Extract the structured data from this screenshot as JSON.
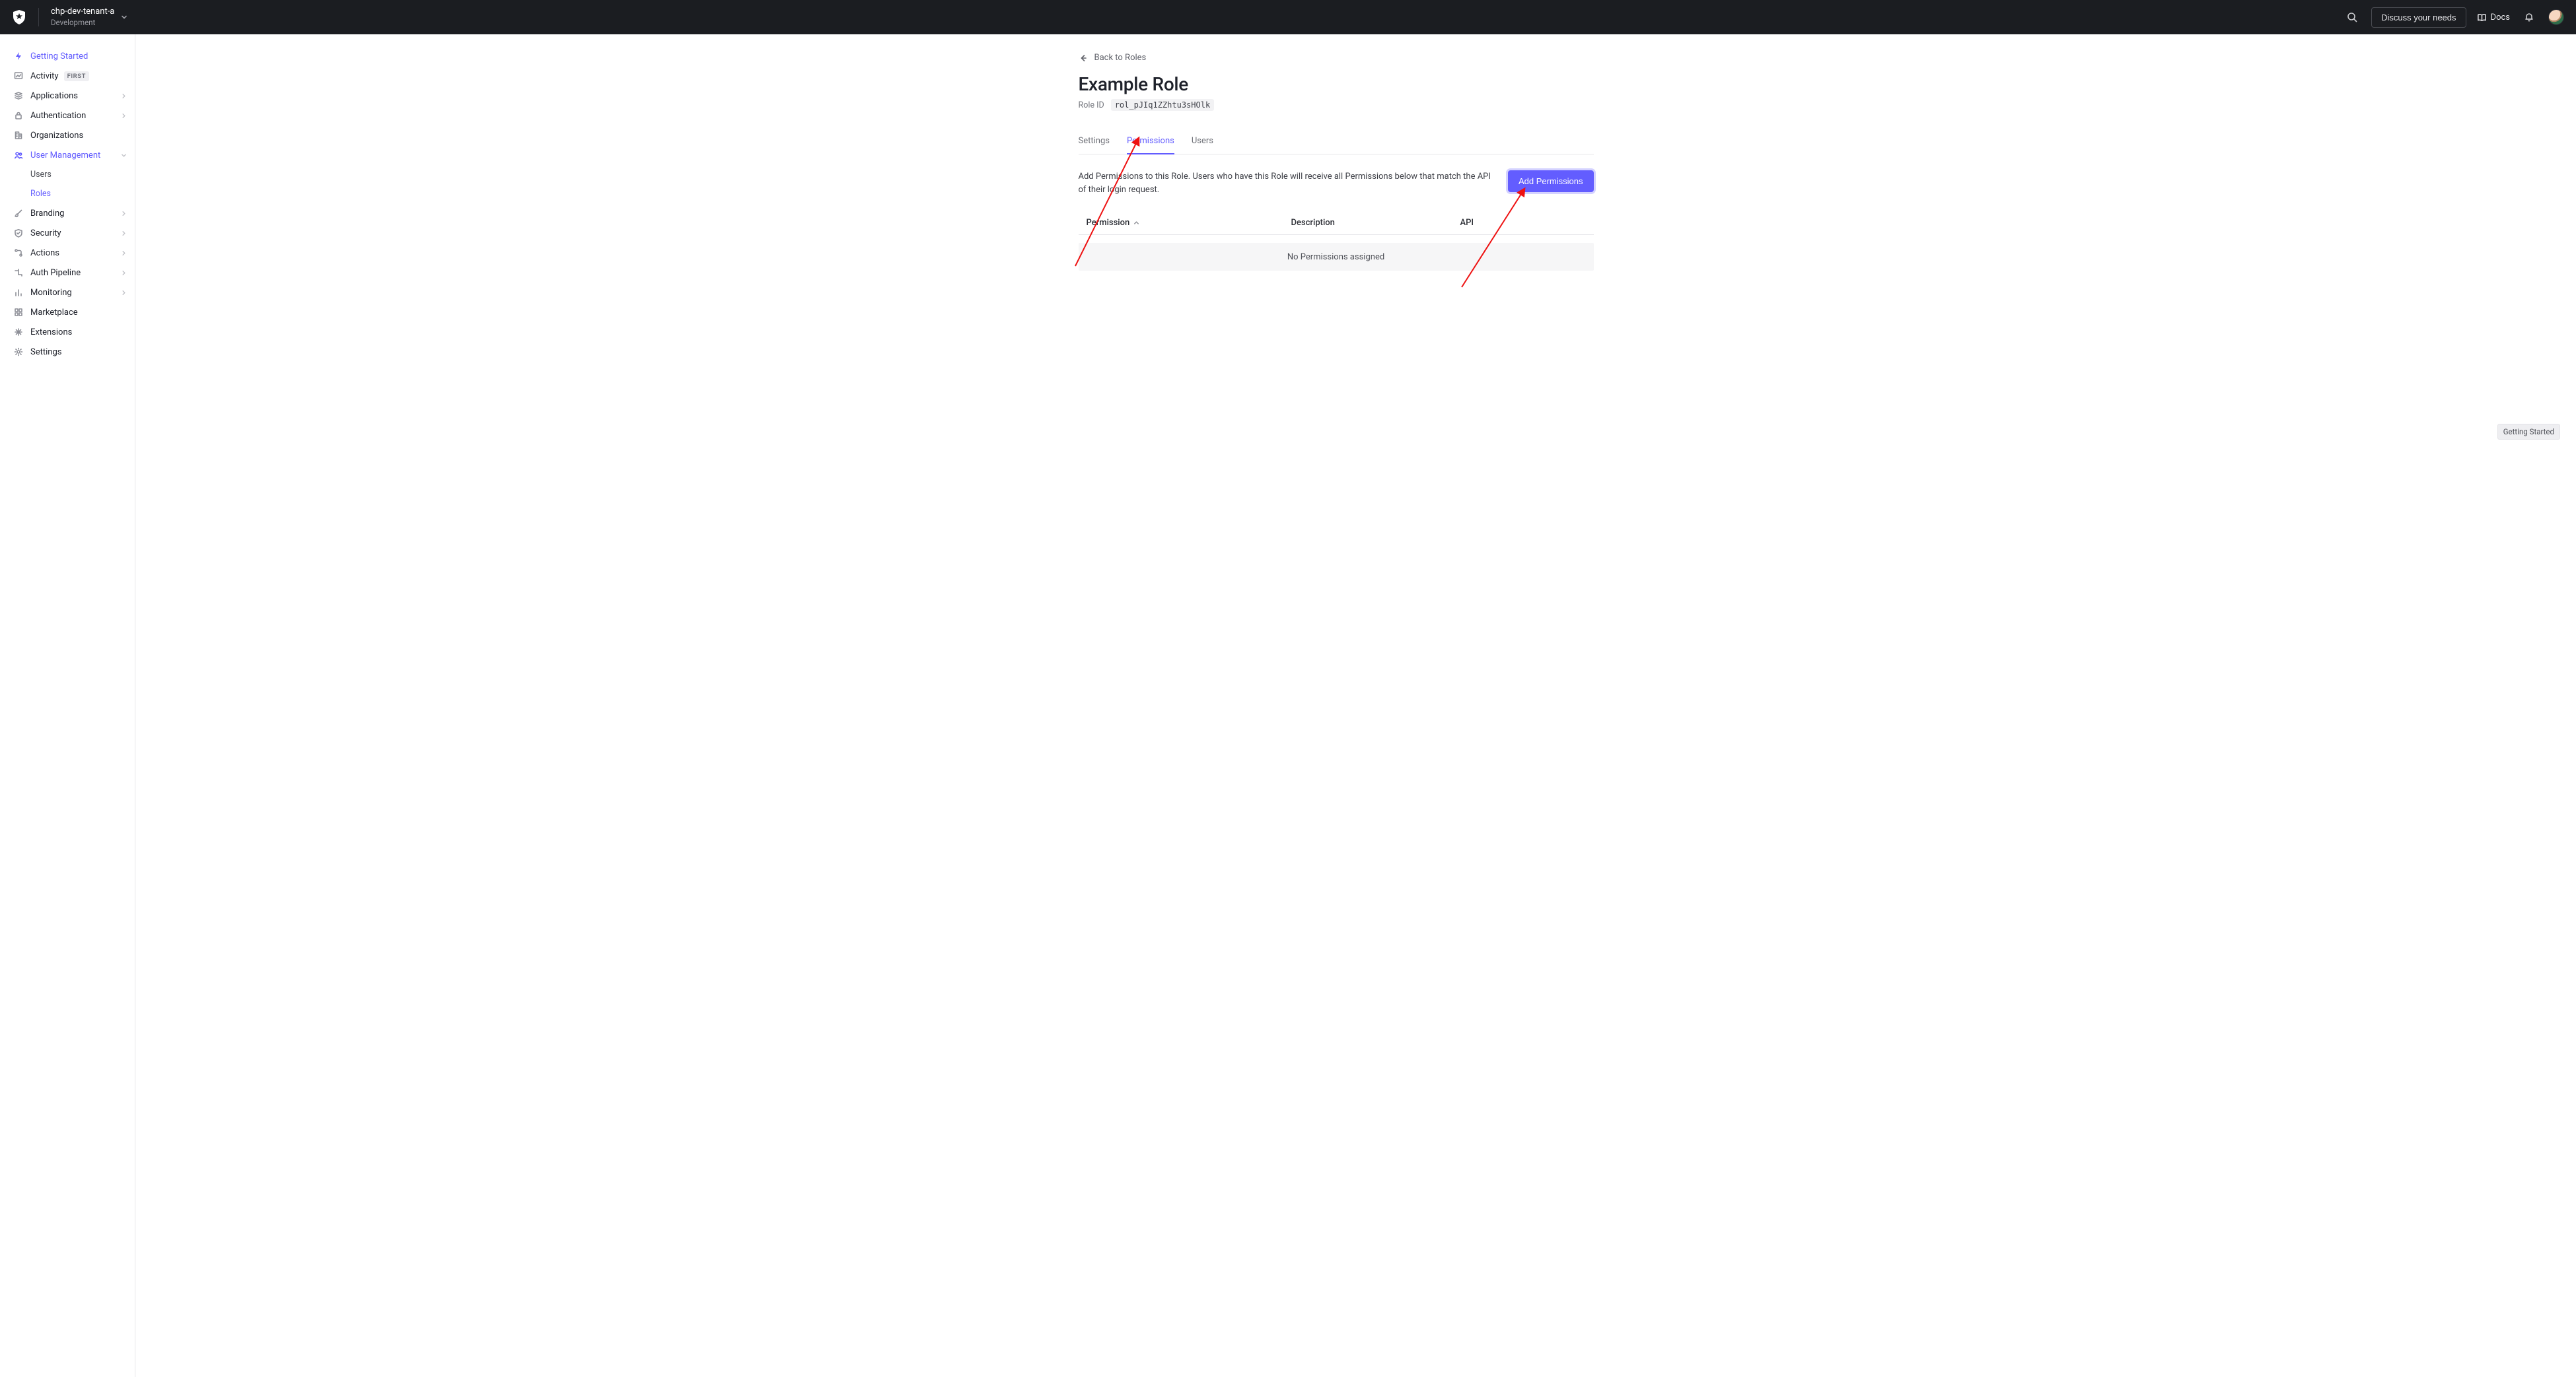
{
  "header": {
    "tenant_name": "chp-dev-tenant-a",
    "tenant_env": "Development",
    "discuss_label": "Discuss your needs",
    "docs_label": "Docs"
  },
  "sidebar": {
    "items": [
      {
        "id": "getting-started",
        "label": "Getting Started"
      },
      {
        "id": "activity",
        "label": "Activity",
        "badge": "FIRST"
      },
      {
        "id": "applications",
        "label": "Applications"
      },
      {
        "id": "authentication",
        "label": "Authentication"
      },
      {
        "id": "organizations",
        "label": "Organizations"
      },
      {
        "id": "user-management",
        "label": "User Management"
      },
      {
        "id": "branding",
        "label": "Branding"
      },
      {
        "id": "security",
        "label": "Security"
      },
      {
        "id": "actions",
        "label": "Actions"
      },
      {
        "id": "auth-pipeline",
        "label": "Auth Pipeline"
      },
      {
        "id": "monitoring",
        "label": "Monitoring"
      },
      {
        "id": "marketplace",
        "label": "Marketplace"
      },
      {
        "id": "extensions",
        "label": "Extensions"
      },
      {
        "id": "settings",
        "label": "Settings"
      }
    ],
    "subitems": {
      "users_label": "Users",
      "roles_label": "Roles"
    }
  },
  "page": {
    "back_label": "Back to Roles",
    "title": "Example Role",
    "role_id_label": "Role ID",
    "role_id_value": "rol_pJIq1ZZhtu3sHOlk",
    "tabs": {
      "settings": "Settings",
      "permissions": "Permissions",
      "users": "Users"
    },
    "perm_description": "Add Permissions to this Role. Users who have this Role will receive all Permissions below that match the API of their login request.",
    "add_permissions_label": "Add Permissions",
    "columns": {
      "permission": "Permission",
      "description": "Description",
      "api": "API"
    },
    "empty_state": "No Permissions assigned"
  },
  "float_chip": "Getting Started"
}
